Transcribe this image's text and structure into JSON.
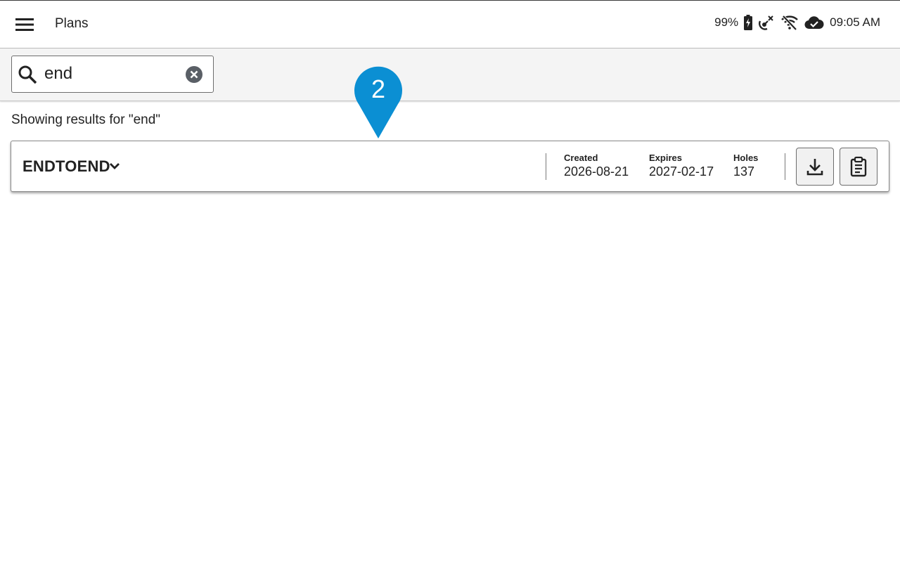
{
  "header": {
    "title": "Plans",
    "battery": "99%",
    "time": "09:05 AM",
    "icons": [
      "menu-icon",
      "battery-charging-icon",
      "satellite-off-icon",
      "wifi-off-icon",
      "cloud-done-icon"
    ]
  },
  "search": {
    "value": "end",
    "placeholder": "",
    "icons": [
      "search-icon",
      "clear-icon"
    ]
  },
  "results": {
    "text": "Showing results for \"end\""
  },
  "plan": {
    "name": "ENDTOEND",
    "created_label": "Created",
    "created_value": "2026-08-21",
    "expires_label": "Expires",
    "expires_value": "2027-02-17",
    "holes_label": "Holes",
    "holes_value": "137",
    "icons": [
      "chevron-down-icon",
      "download-icon",
      "clipboard-icon"
    ]
  },
  "marker": {
    "number": "2",
    "color": "#0b8fd3"
  },
  "colors": {
    "marker": "#0b8fd3",
    "toolbar_bg": "#f4f4f4",
    "text": "#222222"
  }
}
